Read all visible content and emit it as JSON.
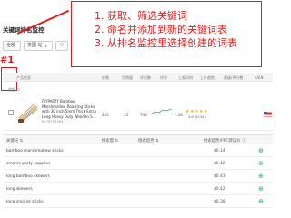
{
  "page": {
    "title": "关键词排名监控"
  },
  "selectors": {
    "group": "全部",
    "market": "美国 站",
    "filter": "▽"
  },
  "callout": {
    "line1": "1. 获取、筛选关键词",
    "line2": "2. 命名并添加到新的关键词表",
    "line3": "3. 从排名监控里选择创建的词表"
  },
  "gutter": {
    "label1": "#1",
    "label2": "2"
  },
  "table_headers": [
    "产品信息",
    "价格",
    "月销量",
    "评分数",
    "评分",
    "上架时间",
    "上升趋势",
    "星级/评分数",
    "ASIN"
  ],
  "expand_label": "收起 ⊟",
  "product": {
    "title": "FLYPARTY Bamboo Marshmallow Roasting Sticks with 30 inch 5mm Thick Extra Long Heavy Duty Wooden S...",
    "asin": "B07BTR43B4",
    "price": "245",
    "sales": "35",
    "reviews": "735",
    "rating_count": "1.2K",
    "stars": "★★★★★",
    "rating_text": "4.6 (3234)",
    "flag": "US"
  },
  "keyword_headers": {
    "keyword": "关键词 ⇅",
    "volume": "搜索量 ⇅",
    "trend": "搜索趋势 ⇅",
    "sponsored": "搜索趋势/PPC建议价 ⓘ"
  },
  "keywords": [
    {
      "keyword": "bamboo marshmallow sticks",
      "price": "$0.14"
    },
    {
      "keyword": "smores party supplies",
      "price": "$0.42"
    },
    {
      "keyword": "long bamboo skewers",
      "price": "$0.43"
    },
    {
      "keyword": "long skewers",
      "price": "$0.42"
    },
    {
      "keyword": "long smores sticks",
      "price": "$0.38"
    }
  ],
  "colors": {
    "annotation_red": "#e31b1b",
    "accent_green": "#2ba471",
    "star_orange": "#f5a623"
  }
}
